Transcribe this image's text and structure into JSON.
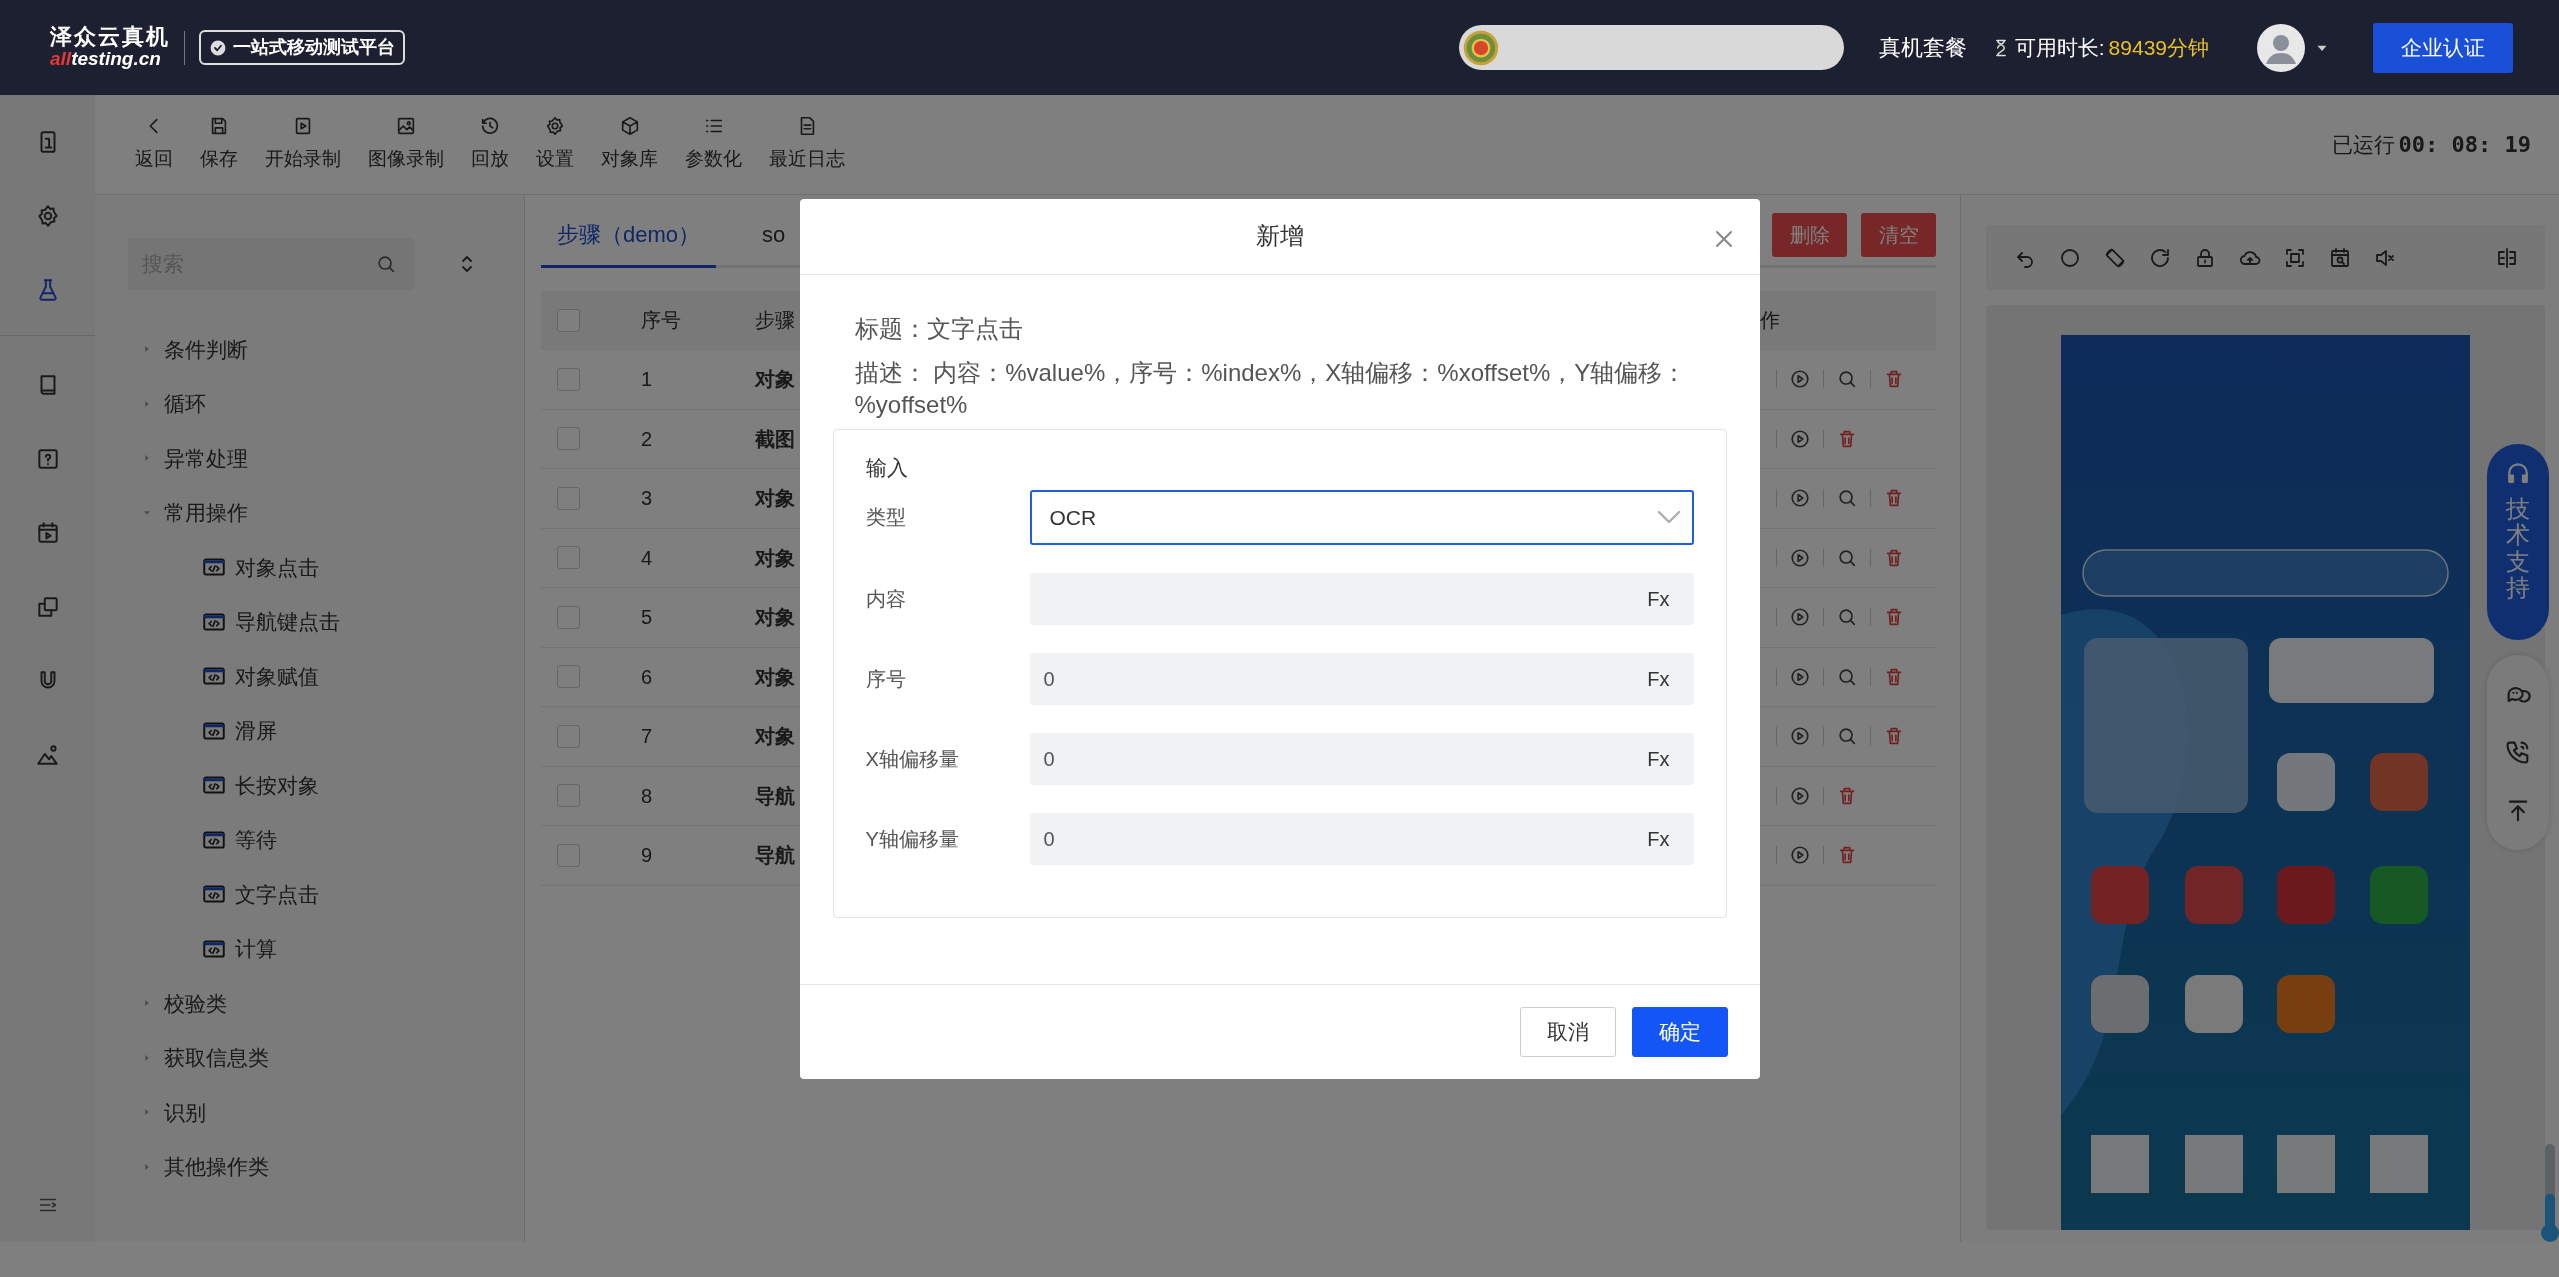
{
  "header": {
    "logo_title": "泽众云真机",
    "logo_domain": [
      "all",
      "testing.cn"
    ],
    "tagline": "一站式移动测试平台",
    "plan_link": "真机套餐",
    "time_label": "可用时长:",
    "time_value": "89439分钟",
    "cert_button": "企业认证"
  },
  "rail": [
    {
      "selected": false
    },
    {
      "selected": false
    },
    {
      "selected": true
    },
    {
      "selected": false
    },
    {
      "selected": false
    },
    {
      "selected": false
    },
    {
      "selected": false
    },
    {
      "selected": false
    },
    {
      "selected": false
    }
  ],
  "toolbar": [
    "返回",
    "保存",
    "开始录制",
    "图像录制",
    "回放",
    "设置",
    "对象库",
    "参数化",
    "最近日志"
  ],
  "run_time": {
    "label": "已运行",
    "value": "00: 08: 19"
  },
  "tree": {
    "search_placeholder": "搜索",
    "items": [
      {
        "label": "条件判断",
        "expanded": false
      },
      {
        "label": "循环",
        "expanded": false
      },
      {
        "label": "异常处理",
        "expanded": false
      },
      {
        "label": "常用操作",
        "expanded": true,
        "children": [
          {
            "label": "对象点击"
          },
          {
            "label": "导航键点击"
          },
          {
            "label": "对象赋值"
          },
          {
            "label": "滑屏"
          },
          {
            "label": "长按对象"
          },
          {
            "label": "等待"
          },
          {
            "label": "文字点击"
          },
          {
            "label": "计算"
          }
        ]
      },
      {
        "label": "校验类",
        "expanded": false
      },
      {
        "label": "获取信息类",
        "expanded": false
      },
      {
        "label": "识别",
        "expanded": false
      },
      {
        "label": "其他操作类",
        "expanded": false
      }
    ]
  },
  "tabs": [
    {
      "label": "步骤（demo）",
      "selected": true
    },
    {
      "label": "so",
      "selected": false
    }
  ],
  "action_buttons": [
    "删除",
    "清空"
  ],
  "table": {
    "all_checked": false,
    "columns": [
      "序号",
      "步骤",
      "作"
    ],
    "rows": [
      {
        "index": "1",
        "step": "对象",
        "checked": false,
        "actions": [
          {
            "kind": "run"
          },
          {
            "kind": "search"
          },
          {
            "kind": "delete"
          }
        ]
      },
      {
        "index": "2",
        "step": "截图",
        "checked": false,
        "actions": [
          {
            "kind": "run"
          },
          {
            "kind": "delete"
          }
        ]
      },
      {
        "index": "3",
        "step": "对象",
        "checked": false,
        "actions": [
          {
            "kind": "run"
          },
          {
            "kind": "search"
          },
          {
            "kind": "delete"
          }
        ]
      },
      {
        "index": "4",
        "step": "对象",
        "checked": false,
        "actions": [
          {
            "kind": "run"
          },
          {
            "kind": "search"
          },
          {
            "kind": "delete"
          }
        ]
      },
      {
        "index": "5",
        "step": "对象",
        "checked": false,
        "actions": [
          {
            "kind": "run"
          },
          {
            "kind": "search"
          },
          {
            "kind": "delete"
          }
        ]
      },
      {
        "index": "6",
        "step": "对象",
        "checked": false,
        "actions": [
          {
            "kind": "run"
          },
          {
            "kind": "search"
          },
          {
            "kind": "delete"
          }
        ]
      },
      {
        "index": "7",
        "step": "对象",
        "checked": false,
        "actions": [
          {
            "kind": "run"
          },
          {
            "kind": "search"
          },
          {
            "kind": "delete"
          }
        ]
      },
      {
        "index": "8",
        "step": "导航",
        "checked": false,
        "actions": [
          {
            "kind": "run"
          },
          {
            "kind": "delete"
          }
        ]
      },
      {
        "index": "9",
        "step": "导航",
        "checked": false,
        "actions": [
          {
            "kind": "run"
          },
          {
            "kind": "delete"
          }
        ]
      }
    ]
  },
  "device": {
    "support_label": "技术支持",
    "zoom_slider": {
      "level": 0.45
    }
  },
  "dialog": {
    "title": "新增",
    "heading": "标题：文字点击",
    "description": "描述： 内容：%value%，序号：%index%，X轴偏移：%xoffset%，Y轴偏移：%yoffset%",
    "section": "输入",
    "fields": [
      {
        "label": "类型",
        "kind": "select",
        "value": "OCR",
        "focused": true
      },
      {
        "label": "内容",
        "kind": "expression",
        "suffix": "Fx"
      },
      {
        "label": "序号",
        "kind": "expression",
        "value": "0",
        "suffix": "Fx"
      },
      {
        "label": "X轴偏移量",
        "kind": "expression",
        "value": "0",
        "suffix": "Fx"
      },
      {
        "label": "Y轴偏移量",
        "kind": "expression",
        "value": "0",
        "suffix": "Fx"
      }
    ],
    "buttons": [
      {
        "label": "取消",
        "kind": "secondary"
      },
      {
        "label": "确定",
        "kind": "primary"
      }
    ]
  }
}
